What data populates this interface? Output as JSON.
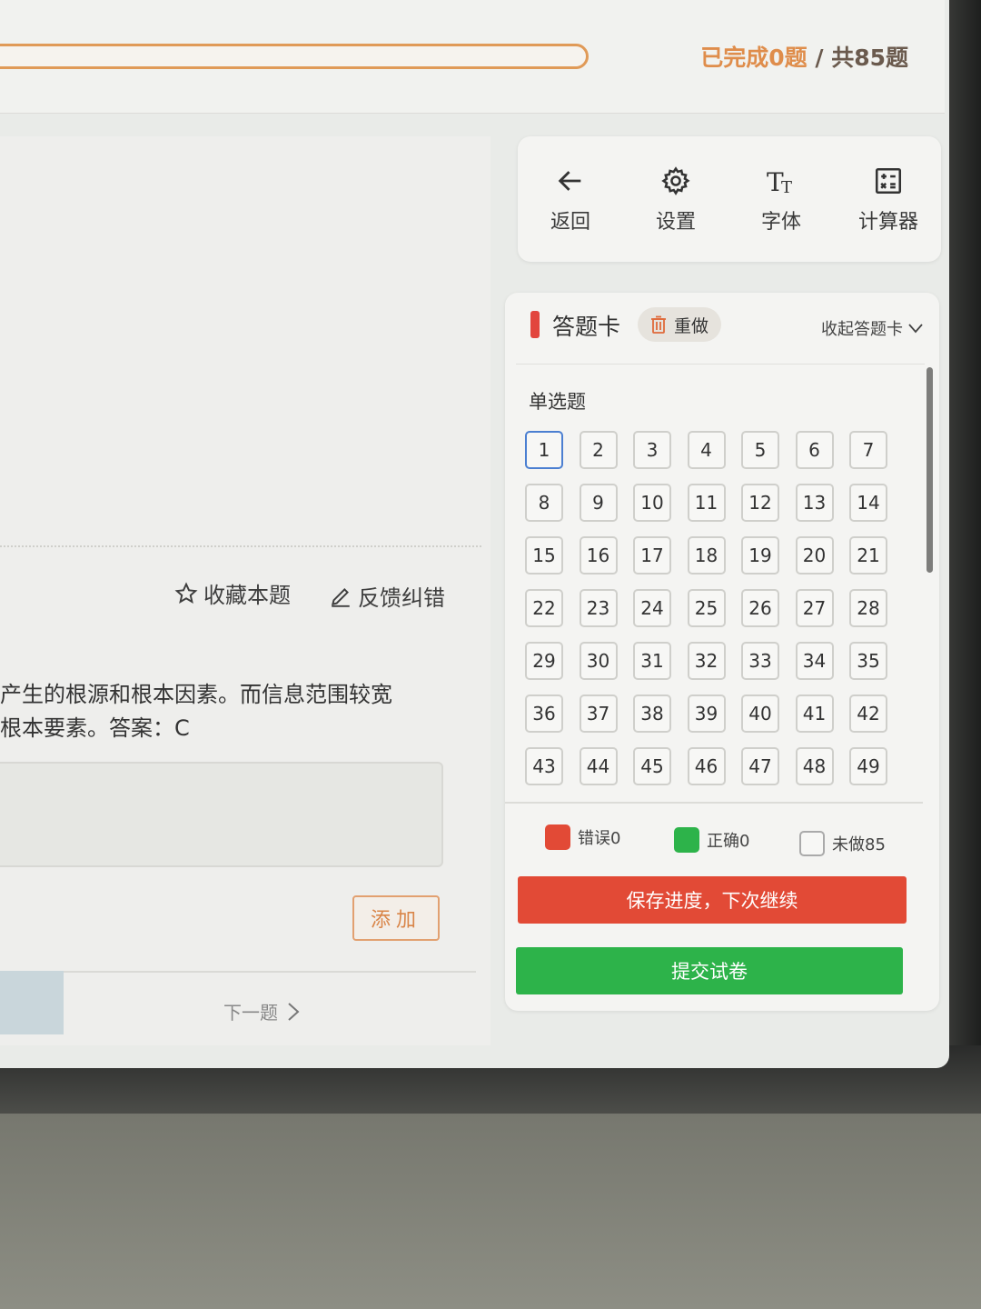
{
  "header": {
    "progress_done": "已完成0题",
    "progress_sep": " / ",
    "progress_total": "共85题",
    "progress_fraction": 0
  },
  "question": {
    "favorite_label": "收藏本题",
    "feedback_label": "反馈纠错",
    "explanation_line1": "产生的根源和根本因素。而信息范围较宽",
    "explanation_line2": "根本要素。答案：C",
    "add_label": "添加",
    "next_label": "下一题"
  },
  "toolbar": {
    "back_label": "返回",
    "settings_label": "设置",
    "font_label": "字体",
    "calculator_label": "计算器"
  },
  "answer_card": {
    "title": "答题卡",
    "redo_label": "重做",
    "collapse_label": "收起答题卡",
    "section_title": "单选题",
    "current_question": 1,
    "numbers": [
      "1",
      "2",
      "3",
      "4",
      "5",
      "6",
      "7",
      "8",
      "9",
      "10",
      "11",
      "12",
      "13",
      "14",
      "15",
      "16",
      "17",
      "18",
      "19",
      "20",
      "21",
      "22",
      "23",
      "24",
      "25",
      "26",
      "27",
      "28",
      "29",
      "30",
      "31",
      "32",
      "33",
      "34",
      "35",
      "36",
      "37",
      "38",
      "39",
      "40",
      "41",
      "42",
      "43",
      "44",
      "45",
      "46",
      "47",
      "48",
      "49"
    ],
    "legend": {
      "wrong_label": "错误0",
      "correct_label": "正确0",
      "undone_label": "未做85"
    },
    "save_button": "保存进度，下次继续",
    "submit_button": "提交试卷"
  },
  "colors": {
    "accent_orange": "#df8d4b",
    "wrong_red": "#e24a36",
    "correct_green": "#2db34a",
    "current_blue": "#4b7fd1"
  }
}
